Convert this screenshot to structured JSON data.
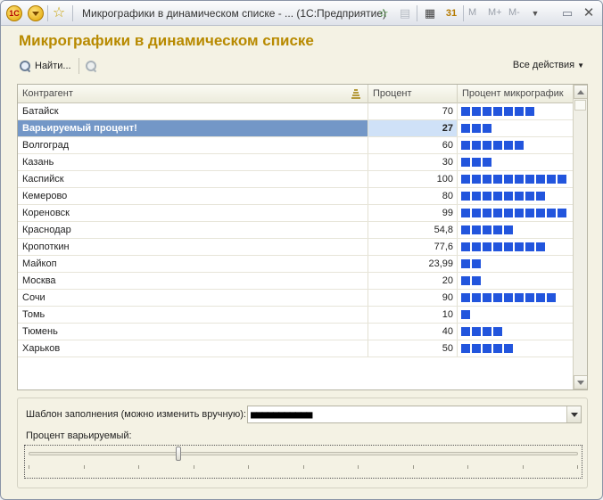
{
  "window": {
    "title": "Микрографики в динамическом списке - ... (1С:Предприятие)",
    "logo_text": "1С",
    "memory": {
      "m": "M",
      "mplus": "M+",
      "mminus": "M-"
    }
  },
  "header": {
    "title": "Микрографики в динамическом списке",
    "find_label": "Найти...",
    "all_actions": "Все действия"
  },
  "table": {
    "columns": {
      "kontragent": "Контрагент",
      "percent": "Процент",
      "micro": "Процент микрографик"
    },
    "rows": [
      {
        "name": "Батайск",
        "percent": "70",
        "blocks": 7
      },
      {
        "name": "Варьируемый процент!",
        "percent": "27",
        "blocks": 3,
        "selected": true
      },
      {
        "name": "Волгоград",
        "percent": "60",
        "blocks": 6
      },
      {
        "name": "Казань",
        "percent": "30",
        "blocks": 3
      },
      {
        "name": "Каспийск",
        "percent": "100",
        "blocks": 10
      },
      {
        "name": "Кемерово",
        "percent": "80",
        "blocks": 8
      },
      {
        "name": "Кореновск",
        "percent": "99",
        "blocks": 10
      },
      {
        "name": "Краснодар",
        "percent": "54,8",
        "blocks": 5
      },
      {
        "name": "Кропоткин",
        "percent": "77,6",
        "blocks": 8
      },
      {
        "name": "Майкоп",
        "percent": "23,99",
        "blocks": 2
      },
      {
        "name": "Москва",
        "percent": "20",
        "blocks": 2
      },
      {
        "name": "Сочи",
        "percent": "90",
        "blocks": 9
      },
      {
        "name": "Томь",
        "percent": "10",
        "blocks": 1
      },
      {
        "name": "Тюмень",
        "percent": "40",
        "blocks": 4
      },
      {
        "name": "Харьков",
        "percent": "50",
        "blocks": 5
      }
    ]
  },
  "form": {
    "template_label": "Шаблон заполнения (можно изменить вручную):",
    "template_value": "■■■■■■■■■■■",
    "variable_label": "Процент варьируемый:",
    "slider_value": 0.27
  },
  "colors": {
    "accent_title": "#b88a00",
    "micro_block": "#2255dd",
    "selection": "#7397c7"
  }
}
